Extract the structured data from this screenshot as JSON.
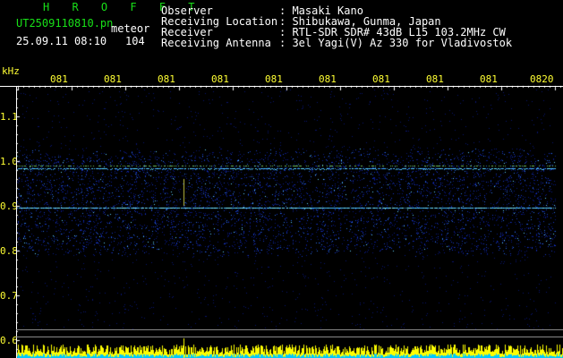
{
  "header": {
    "station": "H R O F F T",
    "filename": "UT2509110810.pn",
    "mode": "meteor",
    "datetime": "25.09.11 08:10",
    "count": "104",
    "fields": [
      {
        "label": "Observer",
        "value": ": Masaki Kano"
      },
      {
        "label": "Receiving Location",
        "value": ": Shibukawa, Gunma, Japan"
      },
      {
        "label": "Receiver",
        "value": ": RTL-SDR SDR# 43dB L15 103.2MHz CW"
      },
      {
        "label": "Receiving Antenna",
        "value": ": 3el Yagi(V) Az 330 for Vladivostok"
      }
    ]
  },
  "axis": {
    "unit": "kHz",
    "y_ticks": [
      "1.1",
      "1.0",
      "0.9",
      "0.8",
      "0.7",
      "0.6"
    ],
    "x_ticks": [
      "081",
      "081",
      "081",
      "081",
      "081",
      "081",
      "081",
      "081",
      "081",
      "0820"
    ]
  },
  "colors": {
    "text_green": "#18e018",
    "text_yellow": "#ffff33",
    "background": "#000000",
    "noise_blue": "#1030c0",
    "signal_cyan": "#60e0ff"
  }
}
